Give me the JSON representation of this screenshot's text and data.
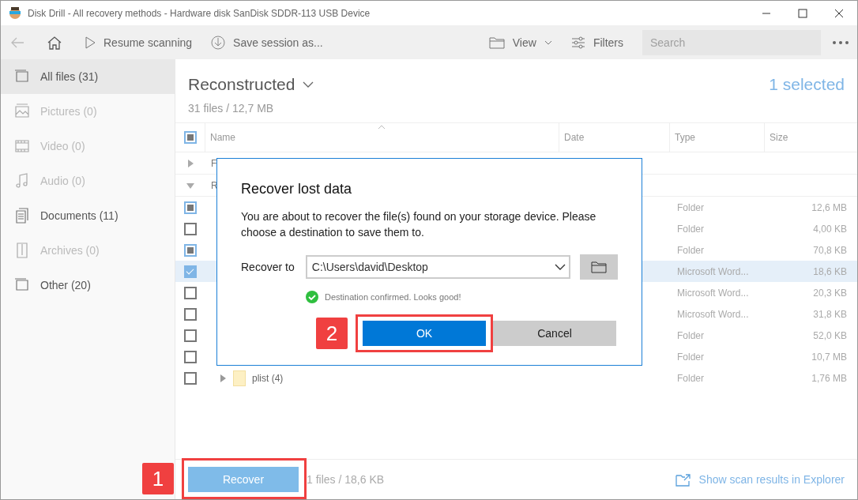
{
  "window": {
    "title": "Disk Drill - All recovery methods - Hardware disk SanDisk SDDR-113 USB Device"
  },
  "toolbar": {
    "resume": "Resume scanning",
    "save": "Save session as...",
    "view": "View",
    "filters": "Filters",
    "search": {
      "placeholder": "Search"
    }
  },
  "sidebar": {
    "items": [
      {
        "label": "All files (31)",
        "selected": true,
        "disabled": false
      },
      {
        "label": "Pictures (0)",
        "selected": false,
        "disabled": true
      },
      {
        "label": "Video (0)",
        "selected": false,
        "disabled": true
      },
      {
        "label": "Audio (0)",
        "selected": false,
        "disabled": true
      },
      {
        "label": "Documents (11)",
        "selected": false,
        "disabled": false
      },
      {
        "label": "Archives (0)",
        "selected": false,
        "disabled": true
      },
      {
        "label": "Other (20)",
        "selected": false,
        "disabled": false
      }
    ]
  },
  "header": {
    "title": "Reconstructed",
    "summary": "31 files / 12,7 MB",
    "selection": "1 selected"
  },
  "table": {
    "select_all": {
      "checked": true,
      "partial": true
    },
    "columns": [
      "Name",
      "Date",
      "Type",
      "Size"
    ],
    "rows": [
      {
        "kind": "group",
        "label": "F",
        "expanded": false
      },
      {
        "kind": "group",
        "label": "R",
        "expanded": true
      },
      {
        "kind": "item",
        "checked": true,
        "partial": true,
        "selected": false,
        "type": "Folder",
        "size": "12,6 MB"
      },
      {
        "kind": "item",
        "checked": false,
        "partial": false,
        "selected": false,
        "type": "Folder",
        "size": "4,00 KB"
      },
      {
        "kind": "item",
        "checked": true,
        "partial": true,
        "selected": false,
        "type": "Folder",
        "size": "70,8 KB"
      },
      {
        "kind": "item",
        "checked": true,
        "partial": false,
        "selected": true,
        "type": "Microsoft Word...",
        "size": "18,6 KB"
      },
      {
        "kind": "item",
        "checked": false,
        "partial": false,
        "selected": false,
        "type": "Microsoft Word...",
        "size": "20,3 KB"
      },
      {
        "kind": "item",
        "checked": false,
        "partial": false,
        "selected": false,
        "type": "Microsoft Word...",
        "size": "31,8 KB"
      },
      {
        "kind": "item",
        "checked": false,
        "partial": false,
        "selected": false,
        "type": "Folder",
        "size": "52,0 KB"
      },
      {
        "kind": "item",
        "checked": false,
        "partial": false,
        "selected": false,
        "type": "Folder",
        "size": "10,7 MB"
      },
      {
        "kind": "item",
        "checked": false,
        "partial": false,
        "selected": false,
        "name": "plist (4)",
        "expanded": false,
        "type": "Folder",
        "size": "1,76 MB"
      }
    ]
  },
  "footer": {
    "recover": "Recover",
    "summary": "1 files / 18,6 KB",
    "explorer": "Show scan results in Explorer"
  },
  "dialog": {
    "title": "Recover lost data",
    "message": "You are about to recover the file(s) found on your storage device. Please choose a destination to save them to.",
    "recover_to_label": "Recover to",
    "path": "C:\\Users\\david\\Desktop",
    "status": "Destination confirmed. Looks good!",
    "ok": "OK",
    "cancel": "Cancel"
  },
  "annotations": [
    "1",
    "2"
  ]
}
